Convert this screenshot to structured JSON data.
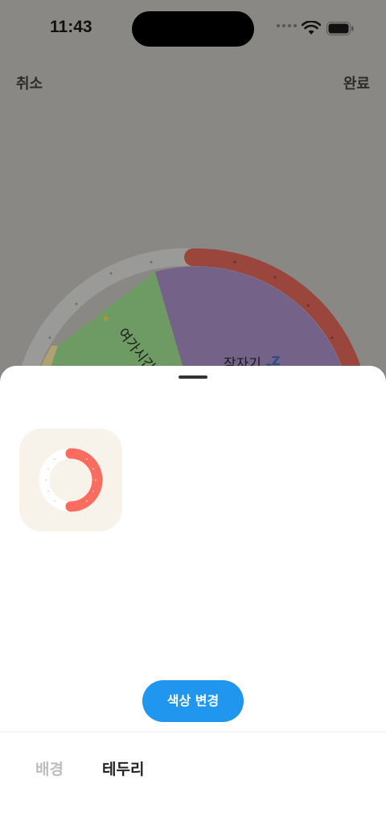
{
  "status": {
    "time": "11:43"
  },
  "nav": {
    "cancel": "취소",
    "done": "완료"
  },
  "wheel": {
    "segments": [
      {
        "label": "여가시간",
        "color": "#6e9a63"
      },
      {
        "label": "잠자기",
        "color": "#756289"
      }
    ],
    "border_color": "#9a463c",
    "track_color": "#9a9a98",
    "sleep_icon": "zzz-icon",
    "leisure_icon": "sparkle-icon"
  },
  "sheet": {
    "color_button": "색상 변경",
    "tabs": [
      {
        "label": "배경",
        "active": false
      },
      {
        "label": "테두리",
        "active": true
      }
    ],
    "preview": {
      "tile_color": "#f7f2ea",
      "ring_color": "#fb6b5e"
    }
  }
}
